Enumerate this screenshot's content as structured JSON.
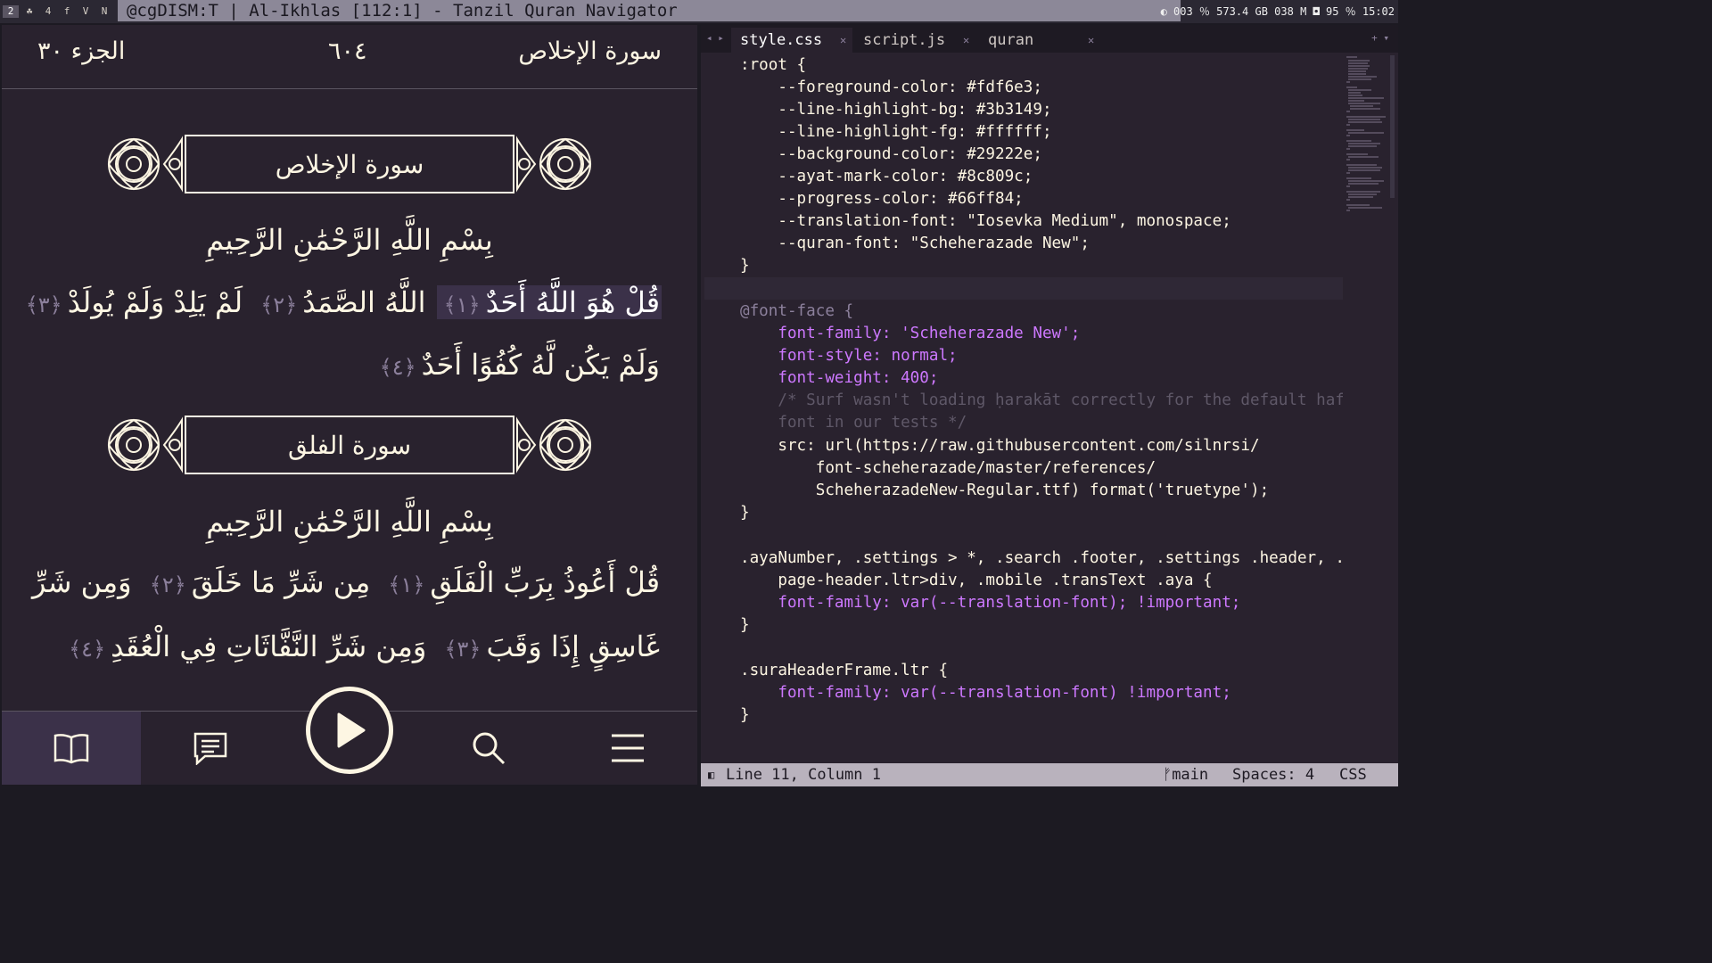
{
  "window": {
    "workspaces": [
      "2",
      "☘",
      "4",
      "f",
      "V",
      "N"
    ],
    "title": "@cgDISM:T | Al-Ikhlas [112:1] - Tanzil Quran Navigator",
    "status": "◐ 003 ％ 573.4 GB 038 M ◘ 95 ％ 15:02"
  },
  "reader": {
    "header": {
      "surah": "سورة الإخلاص",
      "page": "٦٠٤",
      "juz": "الجزء ٣٠"
    },
    "surah1": {
      "name": "سورة الإخلاص",
      "basmala": "بِسْمِ اللَّهِ الرَّحْمَٰنِ الرَّحِيمِ",
      "ayat": [
        {
          "text": "قُلْ هُوَ اللَّهُ أَحَدٌ",
          "mark": "﴿١﴾"
        },
        {
          "text": "اللَّهُ الصَّمَدُ",
          "mark": "﴿٢﴾"
        },
        {
          "text": "لَمْ يَلِدْ وَلَمْ يُولَدْ",
          "mark": "﴿٣﴾"
        },
        {
          "text": "وَلَمْ يَكُن لَّهُ كُفُوًا أَحَدٌ",
          "mark": "﴿٤﴾"
        }
      ]
    },
    "surah2": {
      "name": "سورة الفلق",
      "basmala": "بِسْمِ اللَّهِ الرَّحْمَٰنِ الرَّحِيمِ",
      "ayat": [
        {
          "text": "قُلْ أَعُوذُ بِرَبِّ الْفَلَقِ",
          "mark": "﴿١﴾"
        },
        {
          "text": "مِن شَرِّ مَا خَلَقَ",
          "mark": "﴿٢﴾"
        },
        {
          "text": "وَمِن شَرِّ",
          "mark": ""
        },
        {
          "text": "غَاسِقٍ إِذَا وَقَبَ",
          "mark": "﴿٣﴾"
        },
        {
          "text": "وَمِن شَرِّ النَّفَّاثَاتِ فِي الْعُقَدِ",
          "mark": "﴿٤﴾"
        }
      ]
    },
    "nav": [
      "book-icon",
      "comments-icon",
      "play-icon",
      "search-icon",
      "menu-icon"
    ]
  },
  "editor": {
    "tabs": [
      {
        "label": "style.css",
        "active": true
      },
      {
        "label": "script.js",
        "active": false
      },
      {
        "label": "quran",
        "active": false
      }
    ],
    "code": [
      ":root {",
      "    --foreground-color: #fdf6e3;",
      "    --line-highlight-bg: #3b3149;",
      "    --line-highlight-fg: #ffffff;",
      "    --background-color: #29222e;",
      "    --ayat-mark-color: #8c809c;",
      "    --progress-color: #66ff84;",
      "    --translation-font: \"Iosevka Medium\", monospace;",
      "    --quran-font: \"Scheherazade New\";",
      "}",
      "",
      "@font-face {",
      "    font-family: 'Scheherazade New';",
      "    font-style: normal;",
      "    font-weight: 400;",
      "    /* Surf wasn't loading ḥarakāt correctly for the default hafs",
      "    font in our tests */",
      "    src: url(https://raw.githubusercontent.com/silnrsi/",
      "        font-scheherazade/master/references/",
      "        ScheherazadeNew-Regular.ttf) format('truetype');",
      "}",
      "",
      ".ayaNumber, .settings > *, .search .footer, .settings .header, .",
      "    page-header.ltr>div, .mobile .transText .aya {",
      "    font-family: var(--translation-font); !important;",
      "}",
      "",
      ".suraHeaderFrame.ltr {",
      "    font-family: var(--translation-font) !important;",
      "}"
    ],
    "statusbar": {
      "position": "Line 11, Column 1",
      "branch": "ᚠmain",
      "spaces": "Spaces: 4",
      "lang": "CSS"
    },
    "colors": {
      "bg": "#29222e",
      "fg": "#fdf6e3",
      "highlight": "#3b3149",
      "mark": "#8c809c",
      "progress": "#66ff84"
    }
  }
}
